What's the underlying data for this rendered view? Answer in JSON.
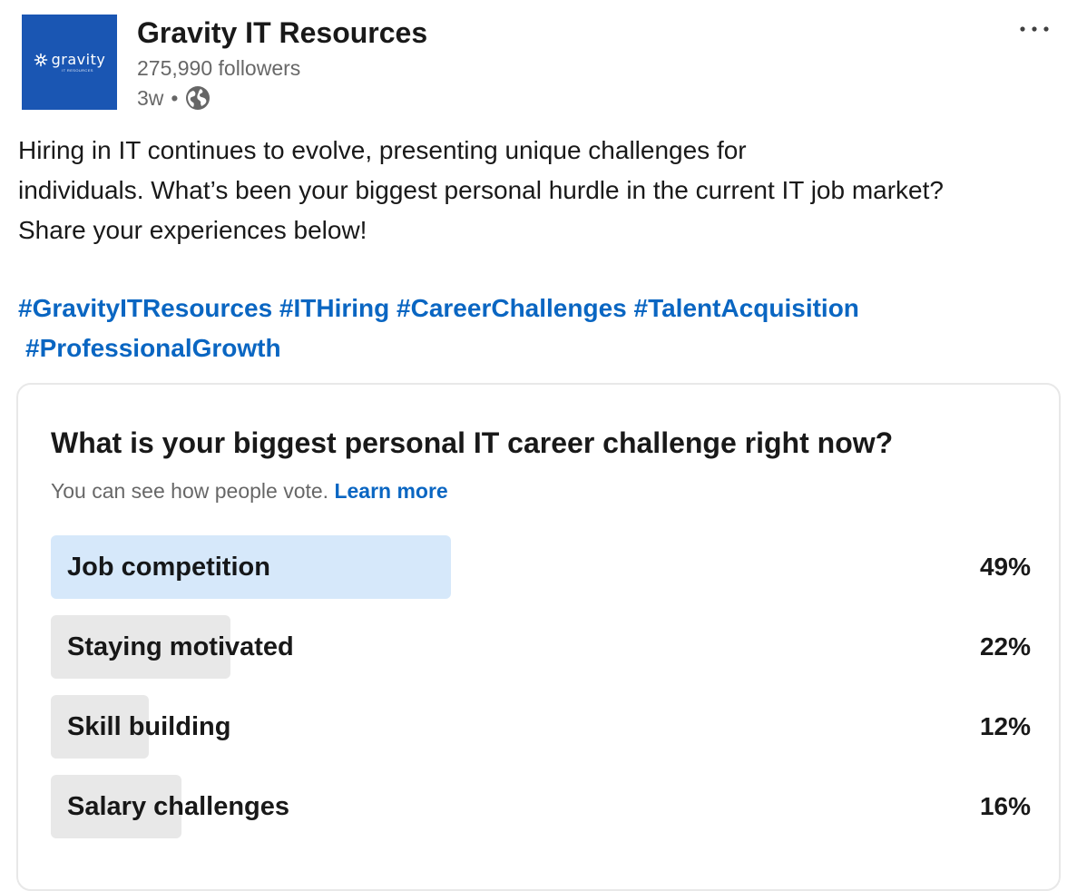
{
  "header": {
    "logo": {
      "word": "gravity",
      "subtitle": "IT RESOURCES",
      "background": "#1a56b3"
    },
    "company_name": "Gravity IT Resources",
    "followers": "275,990 followers",
    "time": "3w",
    "separator": "•",
    "visibility_icon": "globe-icon",
    "more_icon": "ellipsis-icon"
  },
  "post": {
    "paragraph": "Hiring in IT continues to evolve, presenting unique challenges for individuals. What’s been your biggest personal hurdle in the current IT job market? Share your experiences below!",
    "lines": [
      "Hiring in IT continues to evolve, presenting unique challenges for",
      "individuals. What’s been your biggest personal hurdle in the current IT job market?",
      "Share your experiences below!"
    ],
    "hashtags": [
      "#GravityITResources",
      "#ITHiring",
      "#CareerChallenges",
      "#TalentAcquisition",
      "#ProfessionalGrowth"
    ]
  },
  "poll": {
    "question": "What is your biggest personal IT career challenge right now?",
    "note": "You can see how people vote.",
    "learn_more": "Learn more",
    "options": [
      {
        "label": "Job competition",
        "percent_text": "49%",
        "percent": 49,
        "selected": true
      },
      {
        "label": "Staying motivated",
        "percent_text": "22%",
        "percent": 22,
        "selected": false
      },
      {
        "label": "Skill building",
        "percent_text": "12%",
        "percent": 12,
        "selected": false
      },
      {
        "label": "Salary challenges",
        "percent_text": "16%",
        "percent": 16,
        "selected": false
      }
    ]
  },
  "colors": {
    "link": "#0a66c2",
    "selected_bar": "#d6e8fa",
    "bar": "#e8e8e8"
  }
}
